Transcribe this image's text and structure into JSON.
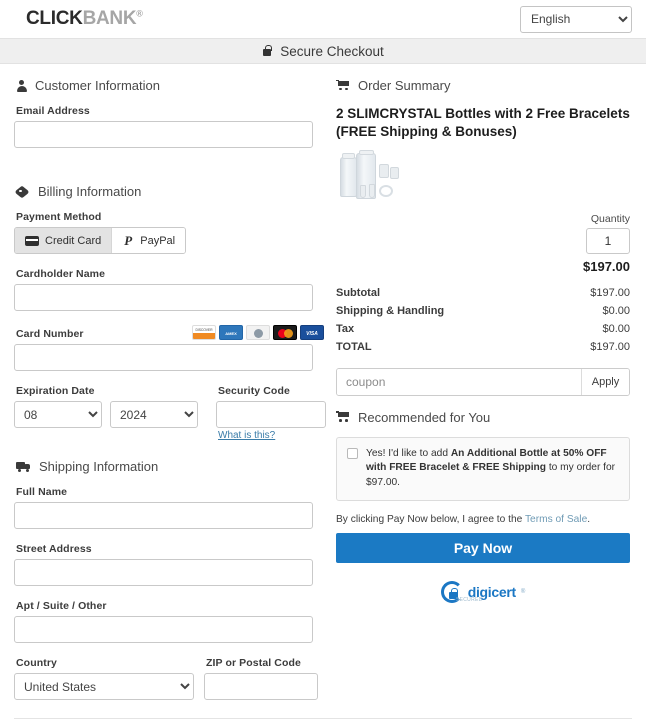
{
  "header": {
    "logo_click": "CLICK",
    "logo_bank": "BANK",
    "logo_reg": "®",
    "language_selected": "English",
    "secure_checkout": "Secure Checkout"
  },
  "customer": {
    "section_title": "Customer Information",
    "email_label": "Email Address",
    "email_value": ""
  },
  "billing": {
    "section_title": "Billing Information",
    "payment_method_label": "Payment Method",
    "method_credit_card": "Credit Card",
    "method_paypal": "PayPal",
    "cardholder_label": "Cardholder Name",
    "cardholder_value": "",
    "card_number_label": "Card Number",
    "card_number_value": "",
    "card_brands": [
      "discover",
      "american-express",
      "diners-club",
      "mastercard",
      "visa"
    ],
    "expiration_label": "Expiration Date",
    "expiration_month": "08",
    "expiration_year": "2024",
    "security_code_label": "Security Code",
    "security_code_value": "",
    "what_is_this": "What is this?"
  },
  "shipping": {
    "section_title": "Shipping Information",
    "full_name_label": "Full Name",
    "full_name_value": "",
    "street_label": "Street Address",
    "street_value": "",
    "apt_label": "Apt / Suite / Other",
    "apt_value": "",
    "country_label": "Country",
    "country_value": "United States",
    "zip_label": "ZIP or Postal Code",
    "zip_value": ""
  },
  "order": {
    "section_title": "Order Summary",
    "product_title": "2 SLIMCRYSTAL Bottles with 2 Free Bracelets (FREE Shipping & Bonuses)",
    "quantity_label": "Quantity",
    "quantity_value": "1",
    "item_price": "$197.00",
    "totals": [
      {
        "label": "Subtotal",
        "value": "$197.00"
      },
      {
        "label": "Shipping & Handling",
        "value": "$0.00"
      },
      {
        "label": "Tax",
        "value": "$0.00"
      },
      {
        "label": "TOTAL",
        "value": "$197.00"
      }
    ],
    "coupon_placeholder": "coupon",
    "coupon_value": "",
    "coupon_apply": "Apply"
  },
  "recommended": {
    "section_title": "Recommended for You",
    "offer_prefix": "Yes! I'd like to add ",
    "offer_bold_1": "An Additional Bottle at 50% OFF with FREE Bracelet & FREE Shipping",
    "offer_suffix": " to my order for $97.00."
  },
  "footer": {
    "terms_prefix": "By clicking Pay Now below, I agree to the ",
    "terms_link": "Terms of Sale",
    "terms_suffix": ".",
    "pay_now": "Pay Now",
    "digicert_name": "digicert",
    "digicert_tm": "®",
    "digicert_sub": "SECURED"
  },
  "colors": {
    "pay_now_blue": "#1b7ac4",
    "digicert_blue": "#1b77c4",
    "band_grey": "#efefef",
    "link_blue": "#3a7ca8"
  }
}
